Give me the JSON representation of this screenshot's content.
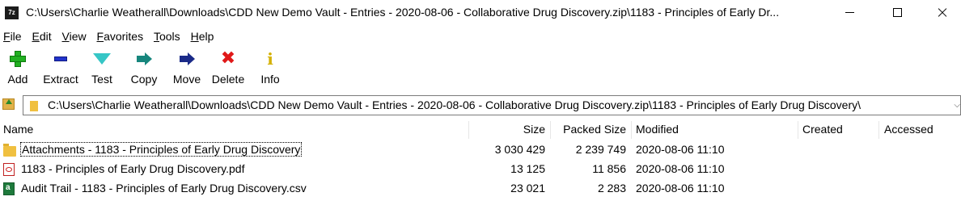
{
  "window": {
    "app_icon_text": "7z",
    "title": "C:\\Users\\Charlie Weatherall\\Downloads\\CDD New Demo Vault - Entries - 2020-08-06 - Collaborative Drug Discovery.zip\\1183 - Principles of Early Dr..."
  },
  "menu": {
    "file": "File",
    "edit": "Edit",
    "view": "View",
    "favorites": "Favorites",
    "tools": "Tools",
    "help": "Help"
  },
  "toolbar": {
    "add": "Add",
    "extract": "Extract",
    "test": "Test",
    "copy": "Copy",
    "move": "Move",
    "delete": "Delete",
    "info": "Info"
  },
  "address": {
    "path": "C:\\Users\\Charlie Weatherall\\Downloads\\CDD New Demo Vault - Entries - 2020-08-06 - Collaborative Drug Discovery.zip\\1183 - Principles of Early Drug Discovery\\"
  },
  "columns": {
    "name": "Name",
    "size": "Size",
    "packed_size": "Packed Size",
    "modified": "Modified",
    "created": "Created",
    "accessed": "Accessed"
  },
  "rows": [
    {
      "name": "Attachments - 1183 - Principles of Early Drug Discovery",
      "size": "3 030 429",
      "packed": "2 239 749",
      "modified": "2020-08-06 11:10",
      "icon": "folder-icon"
    },
    {
      "name": "1183 - Principles of Early Drug Discovery.pdf",
      "size": "13 125",
      "packed": "11 856",
      "modified": "2020-08-06 11:10",
      "icon": "pdf-icon"
    },
    {
      "name": "Audit Trail - 1183 - Principles of Early Drug Discovery.csv",
      "size": "23 021",
      "packed": "2 283",
      "modified": "2020-08-06 11:10",
      "icon": "excel-csv-icon"
    }
  ]
}
